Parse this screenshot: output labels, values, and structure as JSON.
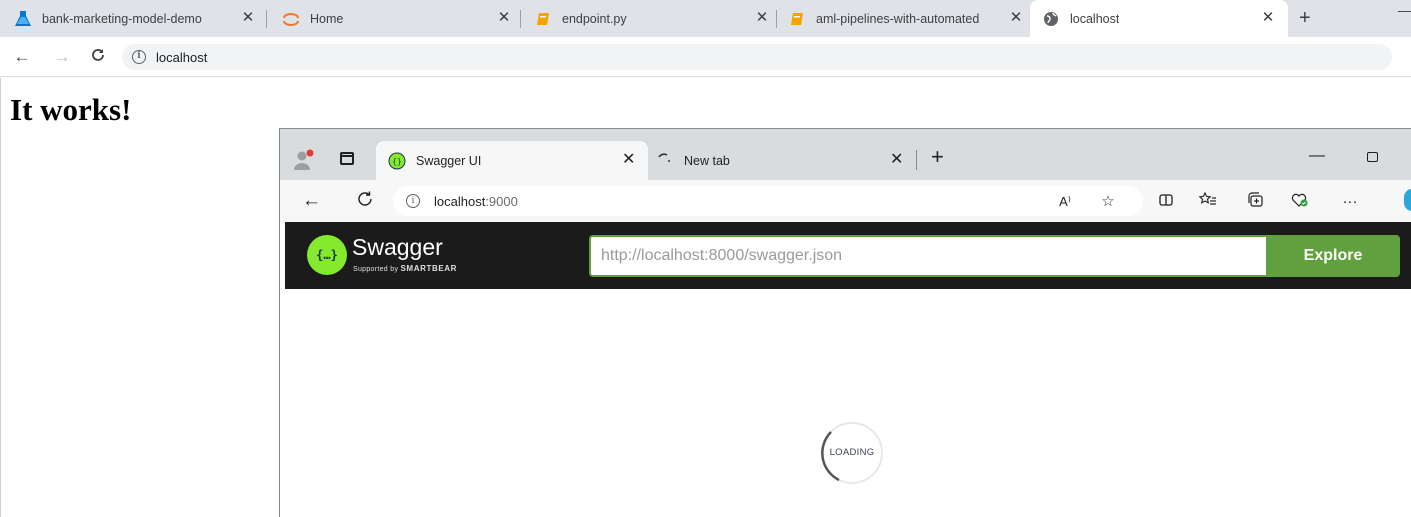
{
  "outer_browser": {
    "tabs": [
      {
        "label": "bank-marketing-model-demo",
        "icon": "azure-ml-flask-icon"
      },
      {
        "label": "Home",
        "icon": "jupyter-icon"
      },
      {
        "label": "endpoint.py",
        "icon": "notebook-icon"
      },
      {
        "label": "aml-pipelines-with-automated",
        "icon": "notebook-icon"
      },
      {
        "label": "localhost",
        "icon": "globe-icon",
        "active": true
      }
    ],
    "address": "localhost"
  },
  "page": {
    "heading": "It works!"
  },
  "inner_browser": {
    "tabs": [
      {
        "label": "Swagger UI",
        "active": true
      },
      {
        "label": "New tab",
        "loading": true
      }
    ],
    "address_host": "localhost",
    "address_port": ":9000",
    "read_aloud_label": "A⁾"
  },
  "swagger": {
    "brand": "Swagger",
    "sub_prefix": "Supported by",
    "sub_brand": "SMARTBEAR",
    "logo_glyph": "{…}",
    "url_value": "http://localhost:8000/swagger.json",
    "explore_label": "Explore",
    "loading_label": "LOADING",
    "brand_color": "#85ea2d",
    "button_color": "#62a03f"
  }
}
